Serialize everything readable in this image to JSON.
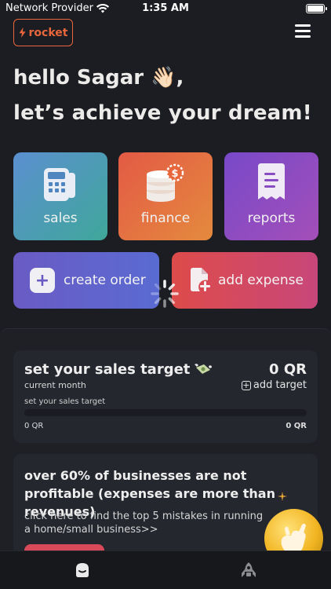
{
  "status_bar": {
    "carrier": "Network Provider",
    "time": "1:35 AM"
  },
  "header": {
    "logo_text": "rocket",
    "accent_color": "#e8663b"
  },
  "greeting": {
    "line1": "hello Sagar 👋🏻,",
    "line2": "let’s achieve your dream!"
  },
  "tiles": [
    {
      "label": "sales",
      "icon": "cash-register-icon"
    },
    {
      "label": "finance",
      "icon": "coins-icon"
    },
    {
      "label": "reports",
      "icon": "receipt-icon"
    }
  ],
  "actions": {
    "create_order": "create order",
    "add_expense": "add expense"
  },
  "sales_target": {
    "title": "set your sales target",
    "period": "current month",
    "amount": "0 QR",
    "add_label": "add target",
    "caption": "set your sales target",
    "progress": 0,
    "min_label": "0 QR",
    "max_label": "0 QR"
  },
  "tip": {
    "headline": "over 60% of businesses are not profitable (expenses are more than revenues)",
    "body": "click here to find the top 5 mistakes in running a home/small business>>"
  },
  "tabbar": {
    "items": [
      "home-icon",
      "rocket-icon"
    ]
  }
}
